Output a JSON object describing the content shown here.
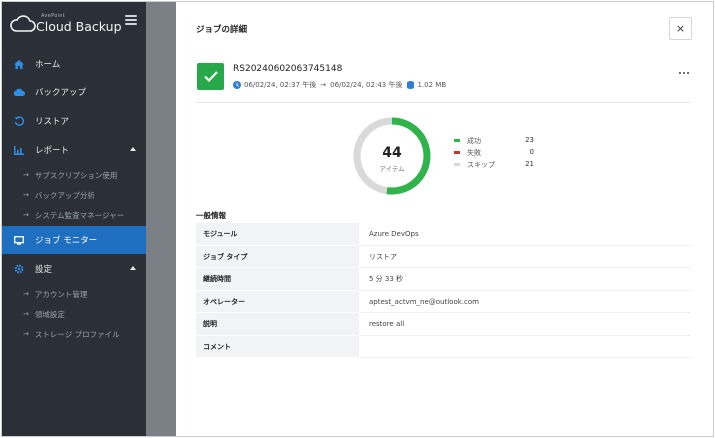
{
  "brand": {
    "sub": "AvePoint",
    "name": "Cloud Backup"
  },
  "sidebar": {
    "items": [
      {
        "label": "ホーム",
        "icon": "home-icon"
      },
      {
        "label": "バックアップ",
        "icon": "cloud-upload-icon"
      },
      {
        "label": "リストア",
        "icon": "restore-icon"
      },
      {
        "label": "レポート",
        "icon": "report-icon"
      },
      {
        "label": "ジョブ モニター",
        "icon": "monitor-icon"
      },
      {
        "label": "設定",
        "icon": "gear-icon"
      }
    ],
    "report_subitems": [
      "サブスクリプション使用",
      "バックアップ分析",
      "システム監査マネージャー"
    ],
    "settings_subitems": [
      "アカウント管理",
      "領域設定",
      "ストレージ プロファイル"
    ],
    "active_color": "#1f6fc0"
  },
  "panel": {
    "title": "ジョブの詳細",
    "close": "×",
    "job": {
      "id": "RS20240602063745148",
      "start": "06/02/24, 02:37 午後",
      "end": "06/02/24, 02:43 午後",
      "size": "1.02 MB",
      "status_color": "#27a94a"
    },
    "summary": {
      "total": "44",
      "total_label": "アイテム",
      "legend": [
        {
          "label": "成功",
          "value": "23",
          "color": "#2fb34a"
        },
        {
          "label": "失敗",
          "value": "0",
          "color": "#c0392b"
        },
        {
          "label": "スキップ",
          "value": "21",
          "color": "#d9d9d9"
        }
      ]
    },
    "general": {
      "title": "一般情報",
      "rows": [
        {
          "key": "モジュール",
          "value": "Azure DevOps"
        },
        {
          "key": "ジョブ タイプ",
          "value": "リストア"
        },
        {
          "key": "継続時間",
          "value": "5 分 33 秒"
        },
        {
          "key": "オペレーター",
          "value": "aptest_actvm_ne@outlook.com"
        },
        {
          "key": "説明",
          "value": "restore all"
        },
        {
          "key": "コメント",
          "value": ""
        }
      ]
    }
  }
}
